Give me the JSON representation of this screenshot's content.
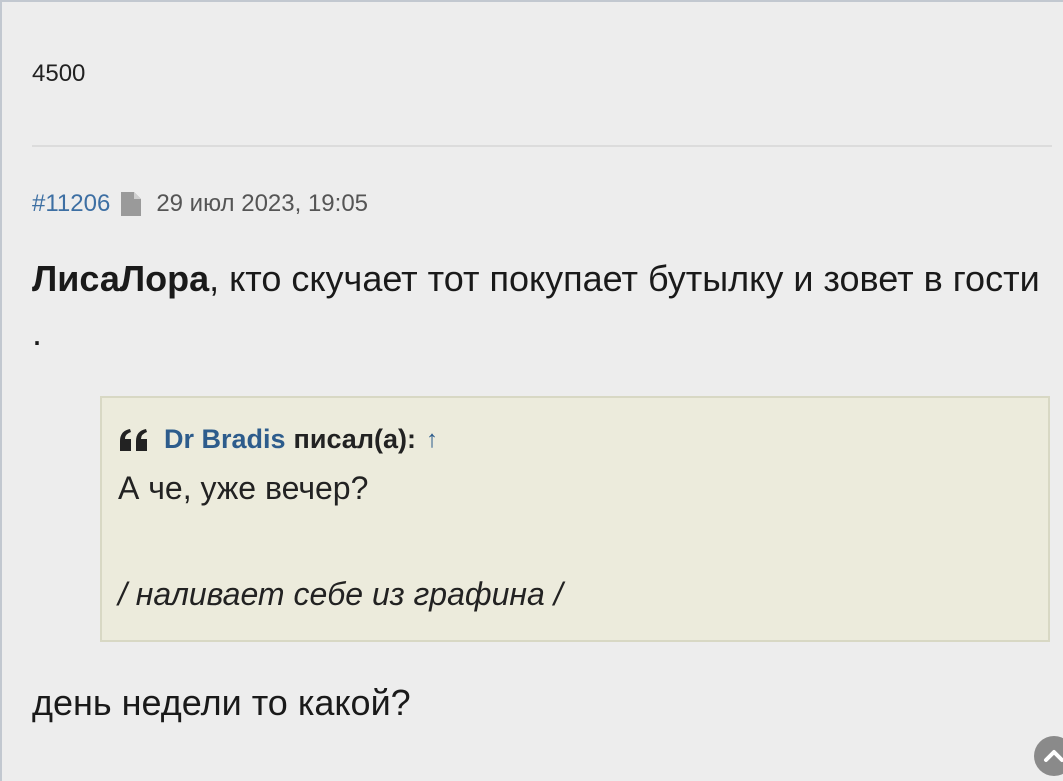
{
  "previous_post": {
    "text": "4500"
  },
  "post": {
    "number": "#11206",
    "date": "29 июл 2023, 19:05",
    "body": {
      "user": "ЛисаЛора",
      "text": ", кто скучает тот покупает бутылку и зовет в гости ."
    },
    "quote": {
      "author": "Dr Bradis",
      "wrote": "писал(а):",
      "arrow": "↑",
      "line1": "А че, уже вечер?",
      "line2": "/ наливает себе из графина /"
    },
    "tail": "день недели то какой?"
  },
  "icons": {
    "doc": "file-icon",
    "quote": "quote-icon",
    "scroll": "chevron-up-icon"
  },
  "colors": {
    "link": "#3d6fa3",
    "quote_bg": "#ecebdc",
    "page_bg": "#ededed"
  }
}
